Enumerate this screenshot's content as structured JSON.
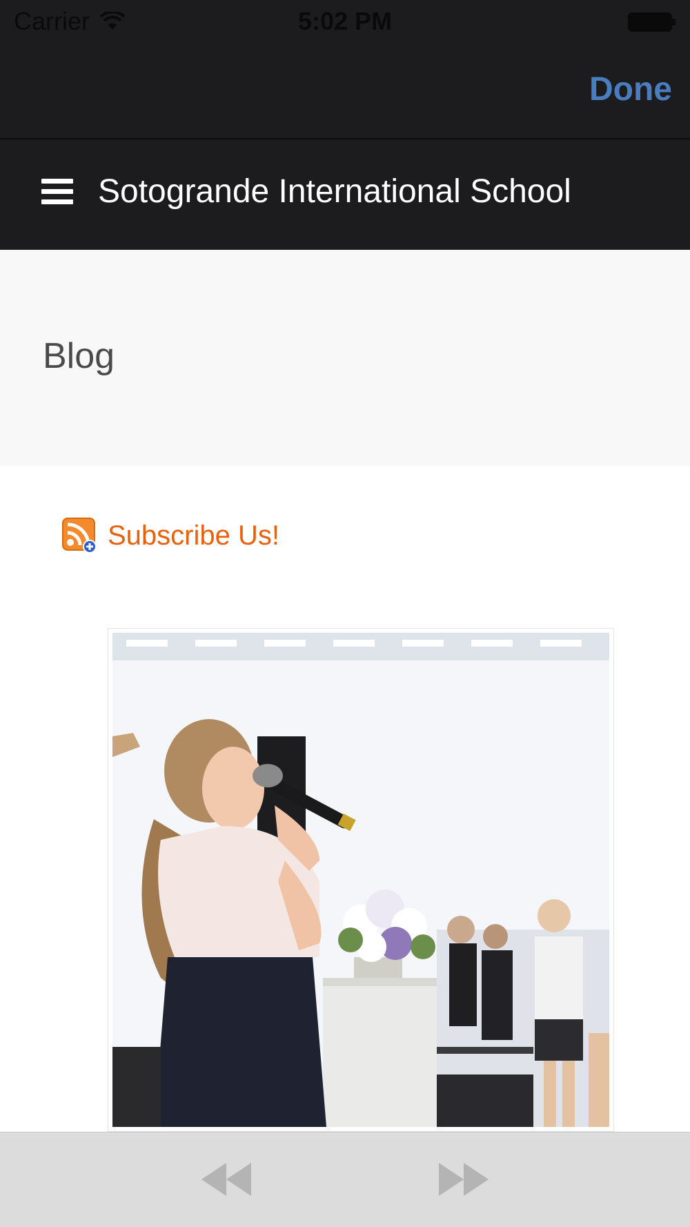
{
  "status_bar": {
    "carrier": "Carrier",
    "time": "5:02 PM",
    "wifi_icon": "wifi-icon",
    "battery_icon": "battery-full-icon"
  },
  "toolbar": {
    "done_label": "Done",
    "done_color": "#4a7cc0"
  },
  "site_header": {
    "menu_icon": "hamburger-menu-icon",
    "title": "Sotogrande International School",
    "background": "#1c1c1e"
  },
  "page": {
    "title": "Blog"
  },
  "content": {
    "subscribe_icon": "rss-feed-icon",
    "subscribe_label": "Subscribe Us!",
    "subscribe_color": "#e8620e",
    "photo_description_icon": "blog-post-photo"
  },
  "bottom_bar": {
    "back_icon": "rewind-back-icon",
    "forward_icon": "fast-forward-icon"
  }
}
